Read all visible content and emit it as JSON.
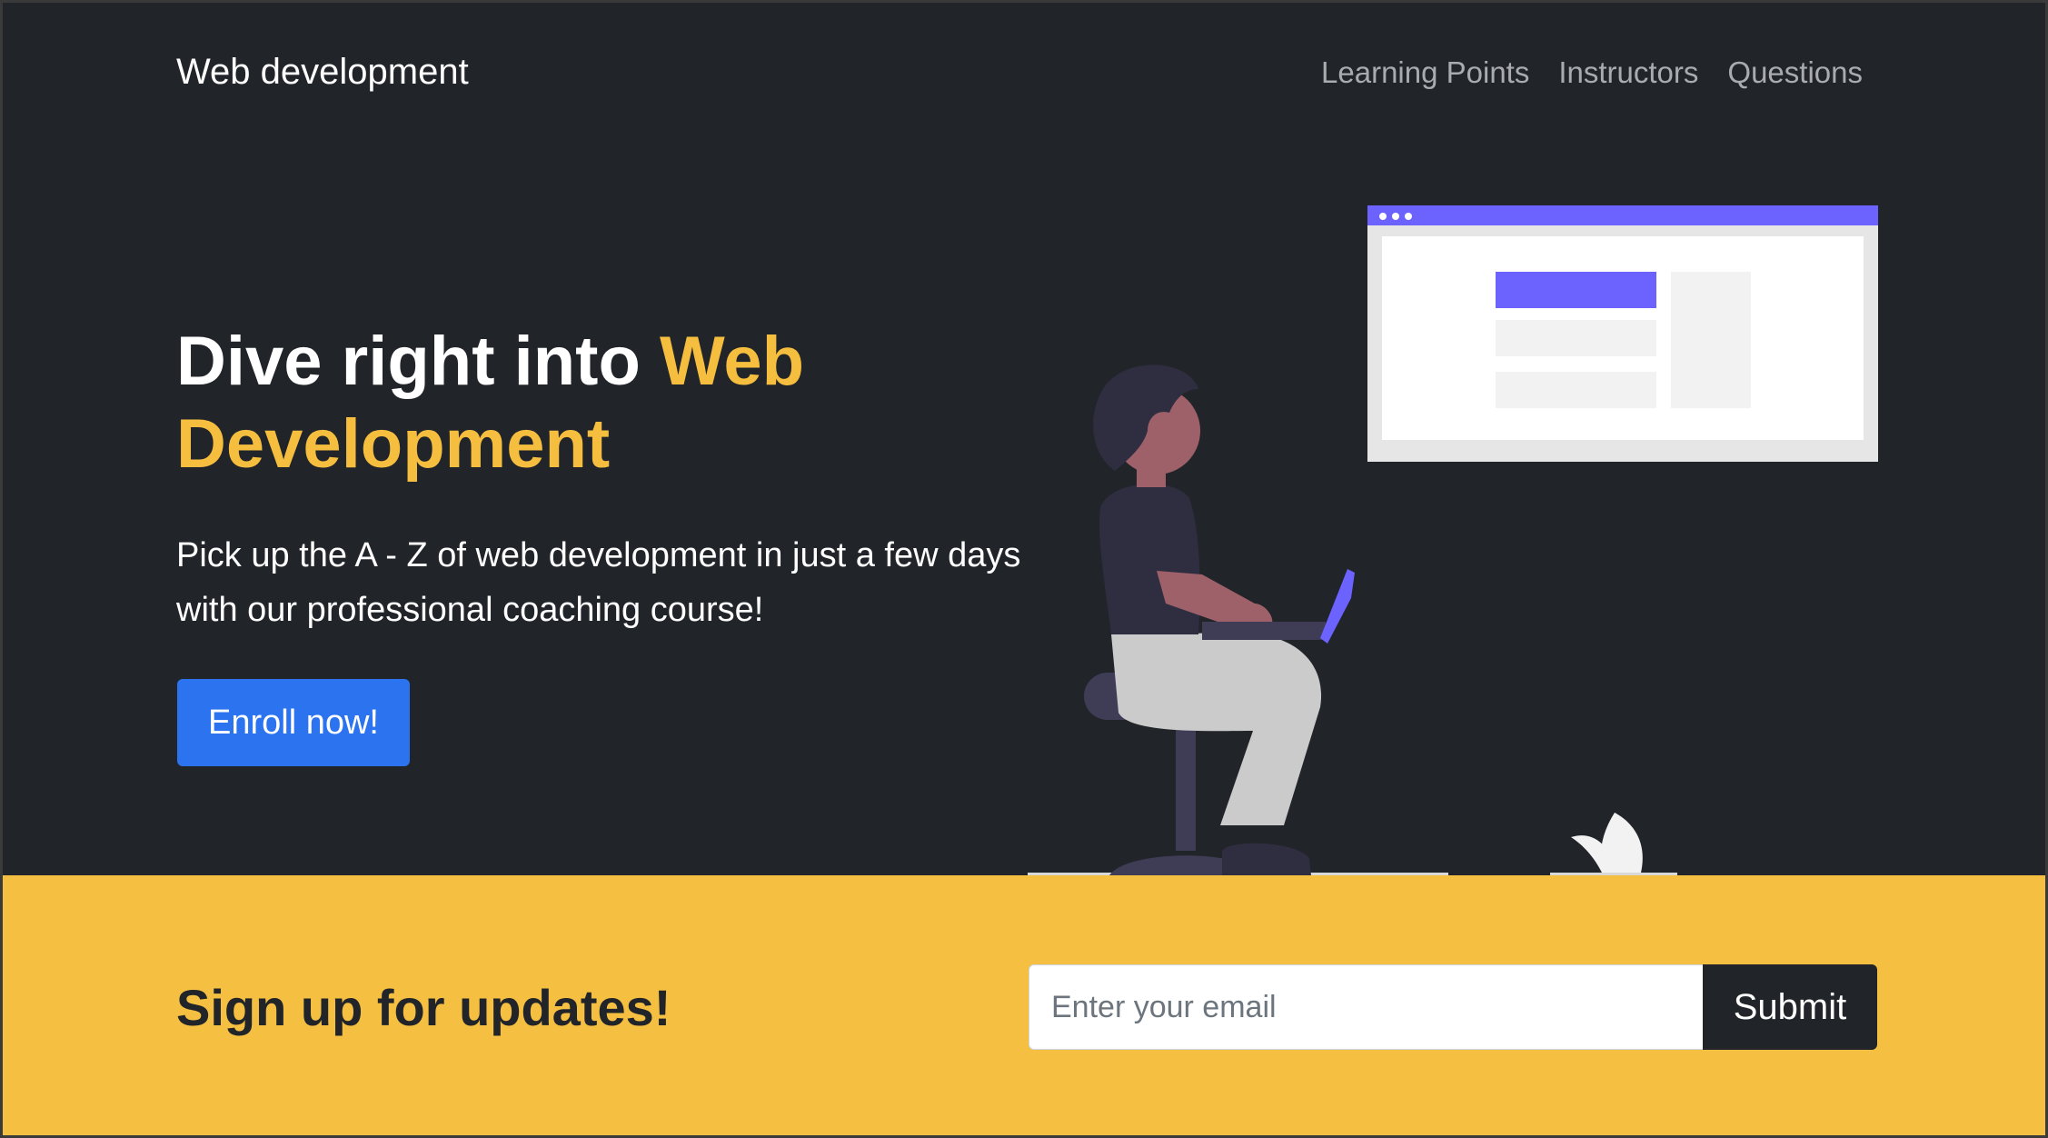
{
  "nav": {
    "brand": "Web development",
    "links": [
      {
        "label": "Learning Points"
      },
      {
        "label": "Instructors"
      },
      {
        "label": "Questions"
      }
    ]
  },
  "hero": {
    "title_lead": "Dive right into ",
    "title_accent": "Web Development",
    "description": "Pick up the A - Z of web development in just a few days with our professional coaching course!",
    "cta_label": "Enroll now!",
    "illustration_icon": "person-with-laptop-illustration"
  },
  "signup": {
    "title": "Sign up for updates!",
    "email_placeholder": "Enter your email",
    "email_value": "",
    "submit_label": "Submit"
  },
  "colors": {
    "hero_background": "#212429",
    "accent_yellow": "#f5be3f",
    "signup_background": "#f5bf41",
    "primary_button": "#2b73ef",
    "dark_button": "#212529",
    "nav_link": "#a9abae",
    "illustration_purple": "#6c63ff"
  }
}
